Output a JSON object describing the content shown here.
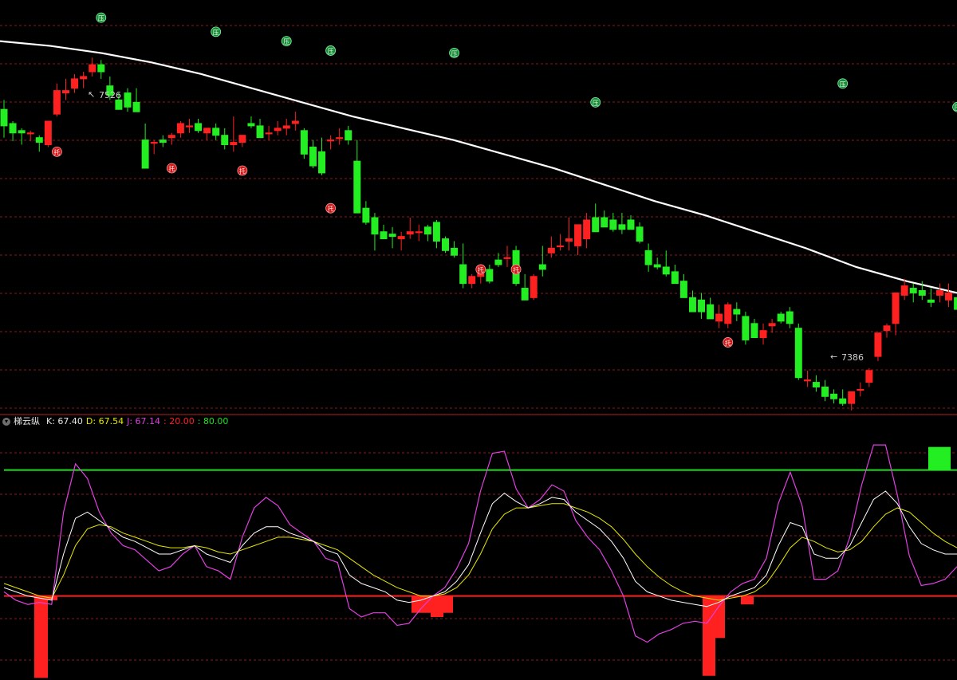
{
  "indicator": {
    "name": "梯云纵",
    "k_label": "K: 67.40",
    "d_label": "D: 67.54",
    "j_label": "J: 67.14",
    "low_label": ": 20.00",
    "high_label": ": 80.00"
  },
  "colors": {
    "bull": "#ff2020",
    "bear": "#22ee22",
    "ma": "#ffffff",
    "grid": "#8a1a1a",
    "k": "#ffffff",
    "d": "#e8e800",
    "j": "#e040e0",
    "level_low": "#ff2020",
    "level_high": "#20e020"
  },
  "chart_data": [
    {
      "type": "candlestick",
      "title": "",
      "annotations": {
        "high": "7526",
        "low": "7386",
        "resistance_marker": "压",
        "support_marker": "托"
      },
      "ohlc": [
        [
          7482,
          7490,
          7458,
          7468
        ],
        [
          7470,
          7472,
          7455,
          7462
        ],
        [
          7464,
          7466,
          7452,
          7462
        ],
        [
          7462,
          7464,
          7455,
          7462
        ],
        [
          7458,
          7460,
          7446,
          7454
        ],
        [
          7452,
          7472,
          7450,
          7472
        ],
        [
          7478,
          7504,
          7476,
          7498
        ],
        [
          7496,
          7508,
          7490,
          7498
        ],
        [
          7500,
          7512,
          7496,
          7508
        ],
        [
          7508,
          7514,
          7500,
          7510
        ],
        [
          7514,
          7526,
          7510,
          7520
        ],
        [
          7520,
          7524,
          7508,
          7514
        ],
        [
          7502,
          7510,
          7490,
          7494
        ],
        [
          7490,
          7496,
          7482,
          7482
        ],
        [
          7496,
          7500,
          7480,
          7484
        ],
        [
          7488,
          7500,
          7482,
          7480
        ],
        [
          7456,
          7470,
          7432,
          7432
        ],
        [
          7454,
          7456,
          7444,
          7454
        ],
        [
          7456,
          7460,
          7450,
          7454
        ],
        [
          7458,
          7462,
          7452,
          7460
        ],
        [
          7462,
          7472,
          7458,
          7470
        ],
        [
          7468,
          7474,
          7462,
          7468
        ],
        [
          7470,
          7474,
          7462,
          7464
        ],
        [
          7462,
          7466,
          7456,
          7466
        ],
        [
          7466,
          7470,
          7456,
          7460
        ],
        [
          7460,
          7466,
          7448,
          7452
        ],
        [
          7452,
          7476,
          7446,
          7454
        ],
        [
          7454,
          7460,
          7450,
          7460
        ],
        [
          7470,
          7476,
          7466,
          7468
        ],
        [
          7468,
          7474,
          7460,
          7458
        ],
        [
          7462,
          7468,
          7456,
          7462
        ],
        [
          7464,
          7472,
          7460,
          7466
        ],
        [
          7466,
          7474,
          7460,
          7468
        ],
        [
          7470,
          7480,
          7464,
          7472
        ],
        [
          7464,
          7466,
          7440,
          7444
        ],
        [
          7450,
          7456,
          7432,
          7434
        ],
        [
          7446,
          7458,
          7426,
          7428
        ],
        [
          7456,
          7460,
          7448,
          7456
        ],
        [
          7458,
          7466,
          7452,
          7458
        ],
        [
          7464,
          7468,
          7452,
          7456
        ],
        [
          7438,
          7456,
          7394,
          7394
        ],
        [
          7398,
          7404,
          7384,
          7386
        ],
        [
          7390,
          7394,
          7362,
          7376
        ],
        [
          7378,
          7384,
          7372,
          7372
        ],
        [
          7376,
          7382,
          7364,
          7374
        ],
        [
          7372,
          7378,
          7362,
          7374
        ],
        [
          7376,
          7390,
          7372,
          7378
        ],
        [
          7378,
          7384,
          7370,
          7378
        ],
        [
          7382,
          7384,
          7370,
          7376
        ],
        [
          7386,
          7388,
          7364,
          7370
        ],
        [
          7372,
          7374,
          7360,
          7362
        ],
        [
          7364,
          7370,
          7356,
          7358
        ],
        [
          7350,
          7368,
          7330,
          7334
        ],
        [
          7334,
          7342,
          7330,
          7340
        ],
        [
          7340,
          7346,
          7334,
          7342
        ],
        [
          7346,
          7350,
          7334,
          7336
        ],
        [
          7354,
          7360,
          7348,
          7350
        ],
        [
          7356,
          7366,
          7348,
          7356
        ],
        [
          7362,
          7366,
          7332,
          7334
        ],
        [
          7330,
          7342,
          7326,
          7320
        ],
        [
          7322,
          7342,
          7320,
          7340
        ],
        [
          7350,
          7366,
          7340,
          7346
        ],
        [
          7360,
          7374,
          7356,
          7364
        ],
        [
          7366,
          7376,
          7362,
          7366
        ],
        [
          7370,
          7390,
          7362,
          7372
        ],
        [
          7366,
          7378,
          7358,
          7384
        ],
        [
          7372,
          7394,
          7364,
          7388
        ],
        [
          7390,
          7402,
          7382,
          7378
        ],
        [
          7390,
          7396,
          7382,
          7382
        ],
        [
          7388,
          7394,
          7378,
          7380
        ],
        [
          7384,
          7394,
          7376,
          7380
        ],
        [
          7388,
          7392,
          7380,
          7380
        ],
        [
          7382,
          7386,
          7368,
          7370
        ],
        [
          7362,
          7368,
          7344,
          7350
        ],
        [
          7350,
          7356,
          7346,
          7348
        ],
        [
          7348,
          7362,
          7340,
          7342
        ],
        [
          7344,
          7350,
          7334,
          7334
        ],
        [
          7336,
          7342,
          7322,
          7322
        ],
        [
          7322,
          7328,
          7310,
          7310
        ],
        [
          7320,
          7326,
          7304,
          7310
        ],
        [
          7316,
          7322,
          7306,
          7304
        ],
        [
          7302,
          7316,
          7296,
          7308
        ],
        [
          7300,
          7318,
          7296,
          7316
        ],
        [
          7312,
          7318,
          7302,
          7308
        ],
        [
          7306,
          7310,
          7282,
          7286
        ],
        [
          7300,
          7304,
          7288,
          7288
        ],
        [
          7288,
          7300,
          7282,
          7294
        ],
        [
          7298,
          7304,
          7292,
          7300
        ],
        [
          7308,
          7310,
          7300,
          7302
        ],
        [
          7310,
          7314,
          7296,
          7300
        ],
        [
          7296,
          7300,
          7252,
          7254
        ],
        [
          7252,
          7260,
          7246,
          7252
        ],
        [
          7250,
          7256,
          7242,
          7246
        ],
        [
          7246,
          7252,
          7234,
          7238
        ],
        [
          7240,
          7244,
          7232,
          7236
        ],
        [
          7236,
          7244,
          7230,
          7232
        ],
        [
          7232,
          7242,
          7226,
          7242
        ],
        [
          7244,
          7250,
          7238,
          7244
        ],
        [
          7250,
          7262,
          7246,
          7260
        ],
        [
          7272,
          7290,
          7268,
          7292
        ],
        [
          7294,
          7300,
          7288,
          7298
        ],
        [
          7300,
          7314,
          7290,
          7326
        ],
        [
          7324,
          7338,
          7320,
          7332
        ],
        [
          7330,
          7334,
          7318,
          7326
        ],
        [
          7328,
          7336,
          7320,
          7324
        ],
        [
          7320,
          7330,
          7314,
          7318
        ],
        [
          7324,
          7334,
          7318,
          7328
        ],
        [
          7320,
          7334,
          7314,
          7326
        ],
        [
          7322,
          7326,
          7310,
          7312
        ]
      ],
      "ma_line": [
        7540,
        7536,
        7530,
        7522,
        7512,
        7500,
        7488,
        7476,
        7466,
        7456,
        7444,
        7432,
        7418,
        7404,
        7392,
        7378,
        7364,
        7348,
        7336,
        7326
      ],
      "resistance_markers": [
        7560,
        7548,
        7540,
        7532,
        7530,
        7488,
        7504,
        7484
      ],
      "support_markers": [
        7446,
        7432,
        7430,
        7398,
        7346,
        7346,
        7284
      ]
    },
    {
      "type": "line",
      "title": "梯云纵",
      "ylim": [
        0,
        100
      ],
      "reference_lines": [
        20,
        80
      ],
      "series": [
        {
          "name": "K",
          "values": [
            24,
            22,
            20,
            19,
            18,
            40,
            57,
            60,
            56,
            52,
            48,
            46,
            43,
            40,
            40,
            42,
            44,
            40,
            38,
            36,
            44,
            50,
            53,
            53,
            50,
            48,
            46,
            42,
            40,
            30,
            26,
            24,
            22,
            18,
            17,
            18,
            20,
            22,
            27,
            35,
            50,
            64,
            69,
            65,
            62,
            64,
            67,
            66,
            60,
            56,
            52,
            46,
            38,
            27,
            22,
            20,
            18,
            17,
            16,
            15,
            17,
            20,
            22,
            24,
            30,
            44,
            55,
            53,
            40,
            38,
            38,
            44,
            55,
            66,
            70,
            64,
            53,
            45,
            42,
            40,
            40
          ]
        },
        {
          "name": "D",
          "values": [
            26,
            24,
            22,
            20,
            19,
            30,
            44,
            52,
            54,
            53,
            50,
            48,
            46,
            44,
            43,
            43,
            44,
            43,
            41,
            40,
            42,
            44,
            46,
            48,
            48,
            47,
            46,
            44,
            42,
            38,
            34,
            30,
            27,
            24,
            22,
            20,
            20,
            21,
            24,
            30,
            40,
            52,
            59,
            62,
            62,
            63,
            64,
            64,
            62,
            60,
            57,
            53,
            47,
            40,
            34,
            29,
            25,
            22,
            20,
            19,
            18,
            19,
            20,
            22,
            26,
            34,
            43,
            48,
            46,
            43,
            41,
            42,
            46,
            53,
            59,
            62,
            60,
            55,
            50,
            46,
            43
          ]
        },
        {
          "name": "J",
          "values": [
            22,
            18,
            16,
            17,
            16,
            60,
            83,
            76,
            60,
            50,
            44,
            42,
            37,
            32,
            34,
            40,
            44,
            34,
            32,
            28,
            48,
            62,
            67,
            63,
            54,
            50,
            46,
            38,
            36,
            14,
            10,
            12,
            12,
            6,
            7,
            14,
            20,
            24,
            33,
            45,
            70,
            88,
            89,
            71,
            62,
            66,
            73,
            70,
            56,
            48,
            42,
            32,
            20,
            1,
            -2,
            2,
            4,
            7,
            8,
            7,
            15,
            22,
            26,
            28,
            38,
            64,
            79,
            63,
            28,
            28,
            32,
            48,
            73,
            92,
            92,
            68,
            39,
            25,
            26,
            28,
            34
          ]
        }
      ],
      "histogram": {
        "color": "bull",
        "values": [
          0,
          0,
          0,
          0,
          -22,
          -4,
          0
        ]
      }
    }
  ]
}
